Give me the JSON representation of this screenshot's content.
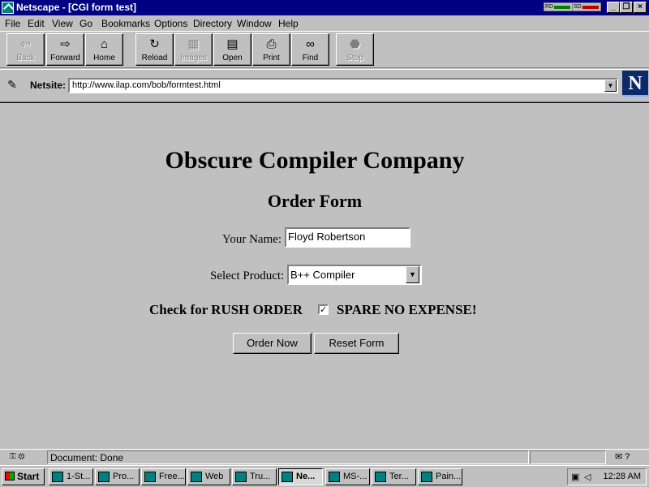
{
  "window": {
    "title": "Netscape - [CGI form test]",
    "meter_rd": "RD",
    "meter_sd": "SD"
  },
  "menu": [
    "File",
    "Edit",
    "View",
    "Go",
    "Bookmarks",
    "Options",
    "Directory",
    "Window",
    "Help"
  ],
  "toolbar": [
    {
      "label": "Back",
      "icon": "back-arrow-icon",
      "enabled": false
    },
    {
      "label": "Forward",
      "icon": "forward-arrow-icon",
      "enabled": true
    },
    {
      "label": "Home",
      "icon": "home-icon",
      "enabled": true
    },
    {
      "label": "Reload",
      "icon": "reload-icon",
      "enabled": true
    },
    {
      "label": "Images",
      "icon": "images-icon",
      "enabled": false
    },
    {
      "label": "Open",
      "icon": "open-icon",
      "enabled": true
    },
    {
      "label": "Print",
      "icon": "print-icon",
      "enabled": true
    },
    {
      "label": "Find",
      "icon": "find-binoculars-icon",
      "enabled": true
    },
    {
      "label": "Stop",
      "icon": "stop-icon",
      "enabled": false
    }
  ],
  "location": {
    "label": "Netsite:",
    "url": "http://www.ilap.com/bob/formtest.html"
  },
  "page": {
    "heading": "Obscure Compiler Company",
    "subheading": "Order Form",
    "name_label": "Your Name:",
    "name_value": "Floyd Robertson",
    "product_label": "Select Product:",
    "product_value": "B++ Compiler",
    "rush_label": "Check for RUSH ORDER",
    "rush_checked": true,
    "rush_suffix": "SPARE NO EXPENSE!",
    "submit_label": "Order Now",
    "reset_label": "Reset Form"
  },
  "status": {
    "text": "Document: Done"
  },
  "taskbar": {
    "start_label": "Start",
    "tasks": [
      {
        "label": "1-St..."
      },
      {
        "label": "Pro..."
      },
      {
        "label": "Free..."
      },
      {
        "label": "Web"
      },
      {
        "label": "Tru..."
      },
      {
        "label": "Ne...",
        "active": true
      },
      {
        "label": "MS-..."
      },
      {
        "label": "Ter..."
      },
      {
        "label": "Pain..."
      }
    ],
    "clock": "12:28 AM"
  },
  "colors": {
    "title_bar": "#000080",
    "face": "#c0c0c0"
  }
}
